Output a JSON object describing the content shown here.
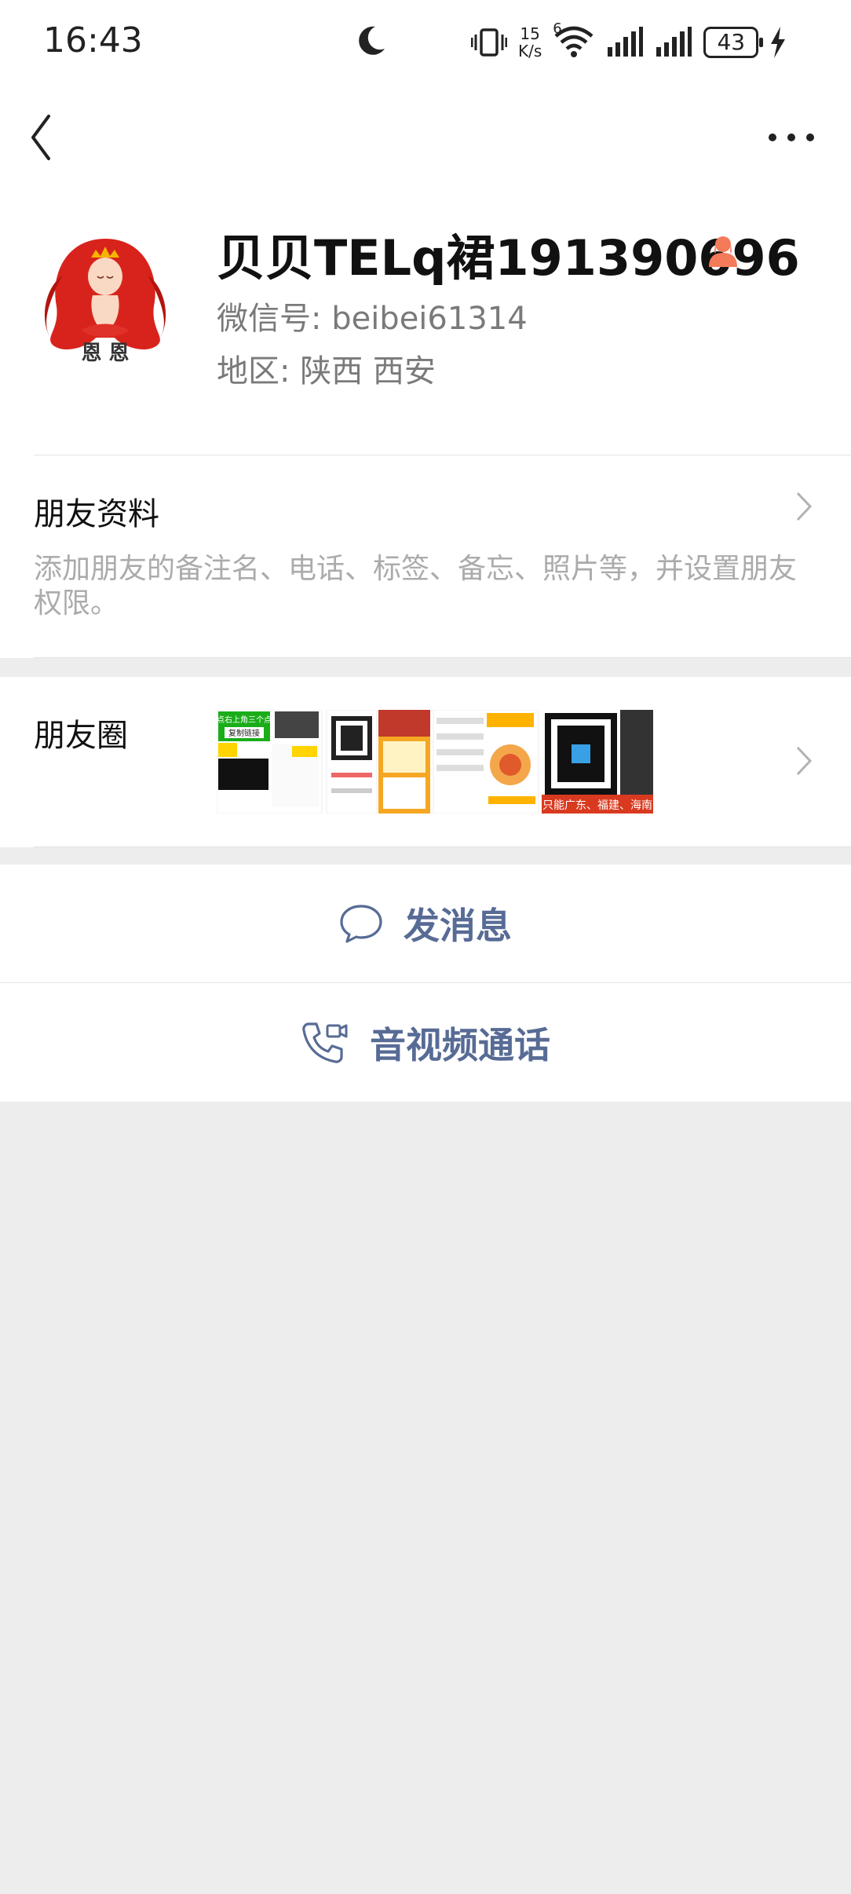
{
  "status_bar": {
    "time": "16:43",
    "net_speed_value": "15",
    "net_speed_unit": "K/s",
    "wifi_badge": "6",
    "battery": "43",
    "icons": [
      "moon-icon",
      "vibrate-icon",
      "wifi-icon",
      "signal-icon",
      "signal-icon",
      "battery-icon",
      "charging-icon"
    ]
  },
  "profile": {
    "nickname": "贝贝TELq裙191390696",
    "wechat_id": "微信号: beibei61314",
    "region": "地区: 陕西  西安",
    "gender_icon": "female-icon",
    "gender_color": "#f37b5a"
  },
  "friend_info": {
    "title": "朋友资料",
    "description": "添加朋友的备注名、电话、标签、备忘、照片等，并设置朋友权限。"
  },
  "moments": {
    "title": "朋友圈",
    "thumb1": {
      "line1": "点右上角三个点",
      "line2": "复制链接"
    },
    "thumb5_caption": "只能广东、福建、海南"
  },
  "actions": {
    "send_message": "发消息",
    "video_call": "音视频通话"
  },
  "colors": {
    "link_blue": "#576b95",
    "background": "#ededed",
    "secondary_text": "#7a7a7a"
  }
}
